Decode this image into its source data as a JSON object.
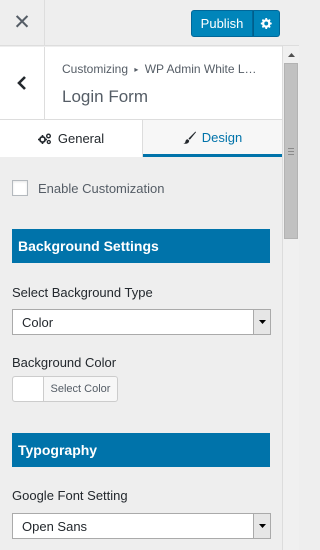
{
  "topbar": {
    "close_icon": "close-icon",
    "publish_label": "Publish",
    "gear_icon": "gear-icon",
    "accent": "#0085ba"
  },
  "header": {
    "back_icon": "chevron-left-icon",
    "breadcrumb_root": "Customizing",
    "breadcrumb_separator": "▸",
    "breadcrumb_plugin": "WP Admin White L…",
    "title": "Login Form"
  },
  "tabs": [
    {
      "label": "General",
      "icon": "cogs-icon",
      "active": false
    },
    {
      "label": "Design",
      "icon": "paintbrush-icon",
      "active": true
    }
  ],
  "design": {
    "enable_label": "Enable Customization",
    "enable_checked": false,
    "background_section": "Background Settings",
    "bg_type_label": "Select Background Type",
    "bg_type_value": "Color",
    "bg_color_label": "Background Color",
    "bg_color_button": "Select Color",
    "bg_color_value": "#ffffff",
    "typography_section": "Typography",
    "font_label": "Google Font Setting",
    "font_value": "Open Sans"
  }
}
